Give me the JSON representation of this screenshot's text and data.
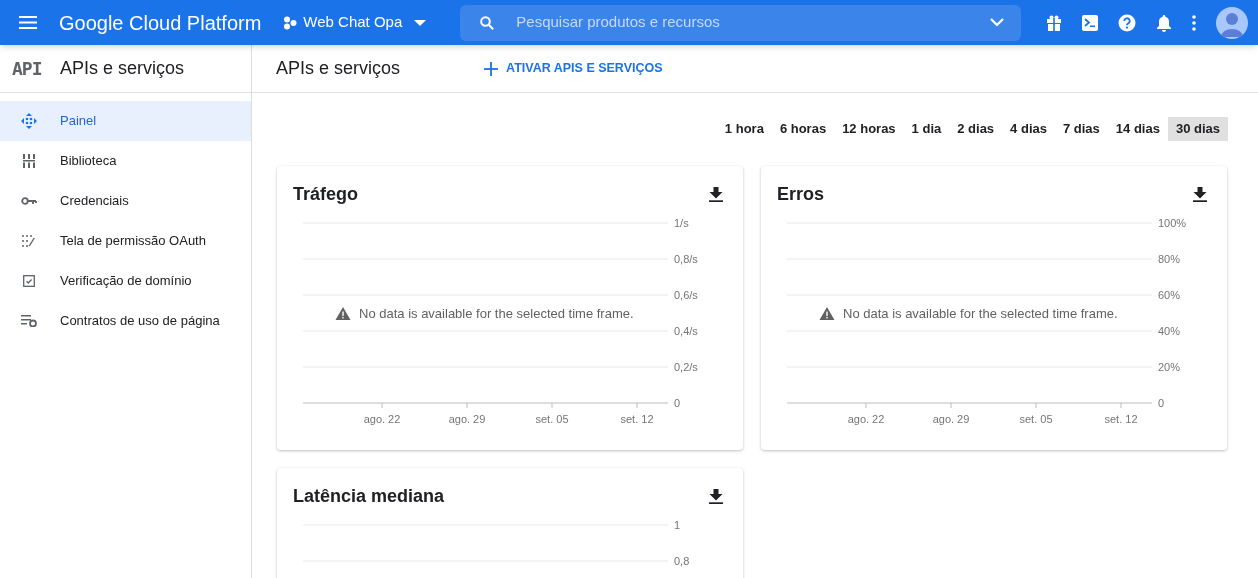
{
  "topbar": {
    "product": "Google Cloud Platform",
    "project": "Web Chat Opa",
    "search": {
      "placeholder": "Pesquisar produtos e recursos"
    }
  },
  "sidebar": {
    "logo": "API",
    "title": "APIs e serviços",
    "items": [
      {
        "label": "Painel",
        "selected": true
      },
      {
        "label": "Biblioteca",
        "selected": false
      },
      {
        "label": "Credenciais",
        "selected": false
      },
      {
        "label": "Tela de permissão OAuth",
        "selected": false
      },
      {
        "label": "Verificação de domínio",
        "selected": false
      },
      {
        "label": "Contratos de uso de página",
        "selected": false
      }
    ]
  },
  "page": {
    "title": "APIs e serviços",
    "action": "ATIVAR APIS E SERVIÇOS"
  },
  "time_ranges": [
    {
      "label": "1 hora",
      "selected": false
    },
    {
      "label": "6 horas",
      "selected": false
    },
    {
      "label": "12 horas",
      "selected": false
    },
    {
      "label": "1 dia",
      "selected": false
    },
    {
      "label": "2 dias",
      "selected": false
    },
    {
      "label": "4 dias",
      "selected": false
    },
    {
      "label": "7 dias",
      "selected": false
    },
    {
      "label": "14 dias",
      "selected": false
    },
    {
      "label": "30 dias",
      "selected": true
    }
  ],
  "cards": [
    {
      "title": "Tráfego",
      "message": "No data is available for the selected time frame.",
      "y_ticks": [
        "1/s",
        "0,8/s",
        "0,6/s",
        "0,4/s",
        "0,2/s",
        "0"
      ],
      "x_ticks": [
        "ago. 22",
        "ago. 29",
        "set. 05",
        "set. 12"
      ]
    },
    {
      "title": "Erros",
      "message": "No data is available for the selected time frame.",
      "y_ticks": [
        "100%",
        "80%",
        "60%",
        "40%",
        "20%",
        "0"
      ],
      "x_ticks": [
        "ago. 22",
        "ago. 29",
        "set. 05",
        "set. 12"
      ]
    },
    {
      "title": "Latência mediana",
      "y_ticks": [
        "1",
        "0,8"
      ]
    }
  ]
}
